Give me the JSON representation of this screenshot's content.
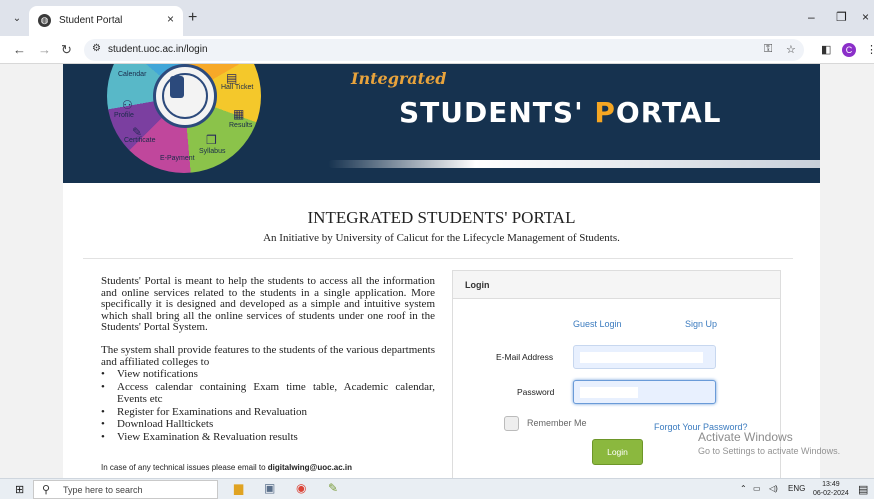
{
  "browser": {
    "tab_title": "Student Portal",
    "tab_close": "×",
    "new_tab": "+",
    "url": "student.uoc.ac.in/login",
    "window": {
      "minimize": "–",
      "restore": "❐",
      "close": "×"
    },
    "profile_initial": "C"
  },
  "banner": {
    "integrated": "Integrated",
    "title_main": "STUDENTS' ",
    "title_p": "P",
    "title_rest": "ORTAL",
    "wheel_labels": {
      "calendar": "Calendar",
      "hall_ticket": "Hall Ticket",
      "profile": "Profile",
      "results": "Results",
      "certificate": "Certificate",
      "syllabus": "Syllabus",
      "epayment": "E-Payment"
    }
  },
  "page": {
    "heading": "INTEGRATED STUDENTS' PORTAL",
    "subheading": "An Initiative by University of Calicut for the Lifecycle Management of Students.",
    "intro_1": "Students' Portal is meant to help the students to access all the information and online services related to the students in a single application. More specifically it is designed and developed as a simple and intuitive system which shall bring all the online services of students under one roof in the Students' Portal System.",
    "intro_2": "The system shall provide features to the students of the various departments and affiliated colleges to",
    "features": [
      "View notifications",
      "Access calendar containing Exam time table, Academic calendar, Events etc",
      "Register for Examinations and Revaluation",
      "Download Halltickets",
      "View Examination & Revaluation results"
    ],
    "help_text": "In case of any technical issues please email to ",
    "help_email": "digitalwing@uoc.ac.in"
  },
  "login": {
    "header": "Login",
    "guest_login": "Guest Login",
    "sign_up": "Sign Up",
    "email_label": "E-Mail Address",
    "password_label": "Password",
    "remember_me": "Remember Me",
    "forgot_password": "Forgot Your Password?",
    "login_button": "Login"
  },
  "watermark": {
    "line1": "Activate Windows",
    "line2": "Go to Settings to activate Windows."
  },
  "taskbar": {
    "search_placeholder": "Type here to search",
    "language": "ENG",
    "time": "13:49",
    "date": "06-02-2024"
  }
}
